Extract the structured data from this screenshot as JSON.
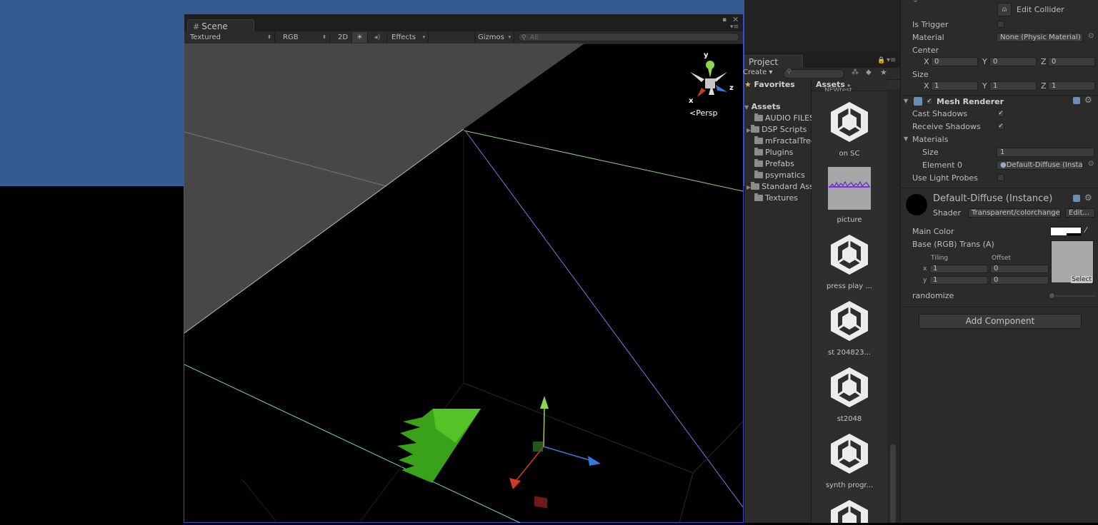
{
  "scene": {
    "tab_label": "Scene",
    "render_mode": "Textured",
    "color_mode": "RGB",
    "mode_2d": "2D",
    "effects": "Effects",
    "gizmos": "Gizmos",
    "search_placeholder": "All",
    "gizmo": {
      "y": "y",
      "x": "x",
      "z": "z",
      "projection": "Persp"
    }
  },
  "project": {
    "tab_label": "Project",
    "create": "Create",
    "favorites": "Favorites",
    "assets_header": "Assets",
    "breadcrumb": "Assets",
    "tree": [
      "AUDIO FILES",
      "DSP Scripts",
      "mFractalTree",
      "Plugins",
      "Prefabs",
      "psymatics",
      "Standard Assets",
      "Textures"
    ],
    "top_cut_label": "NEWtest...",
    "assets": [
      {
        "label": "on SC",
        "kind": "unity"
      },
      {
        "label": "picture",
        "kind": "image"
      },
      {
        "label": "press play ...",
        "kind": "unity"
      },
      {
        "label": "st 204823...",
        "kind": "unity"
      },
      {
        "label": "st2048",
        "kind": "unity"
      },
      {
        "label": "synth progr...",
        "kind": "unity"
      }
    ]
  },
  "inspector": {
    "edit_collider": "Edit Collider",
    "is_trigger": "Is Trigger",
    "material_label": "Material",
    "material_value": "None (Physic Material)",
    "center_label": "Center",
    "center": {
      "x": "0",
      "y": "0",
      "z": "0"
    },
    "size_label": "Size",
    "size": {
      "x": "1",
      "y": "1",
      "z": "1"
    },
    "axis_x": "X",
    "axis_y": "Y",
    "axis_z": "Z",
    "mesh_renderer": "Mesh Renderer",
    "cast_shadows": "Cast Shadows",
    "receive_shadows": "Receive Shadows",
    "materials": "Materials",
    "materials_size_label": "Size",
    "materials_size": "1",
    "element0_label": "Element 0",
    "element0_value": "Default-Diffuse (Instance)",
    "use_light_probes": "Use Light Probes",
    "material_name": "Default-Diffuse (Instance)",
    "shader_label": "Shader",
    "shader_value": "Transparent/colorchange",
    "edit_btn": "Edit...",
    "main_color": "Main Color",
    "base_tex": "Base (RGB) Trans (A)",
    "tiling": "Tiling",
    "offset": "Offset",
    "tx": "x",
    "ty": "y",
    "tiling_x": "1",
    "tiling_y": "1",
    "offset_x": "0",
    "offset_y": "0",
    "select": "Select",
    "randomize": "randomize",
    "add_component": "Add Component"
  },
  "colors": {
    "scene_bg": "#365b91",
    "accent": "#3d4ad1"
  }
}
